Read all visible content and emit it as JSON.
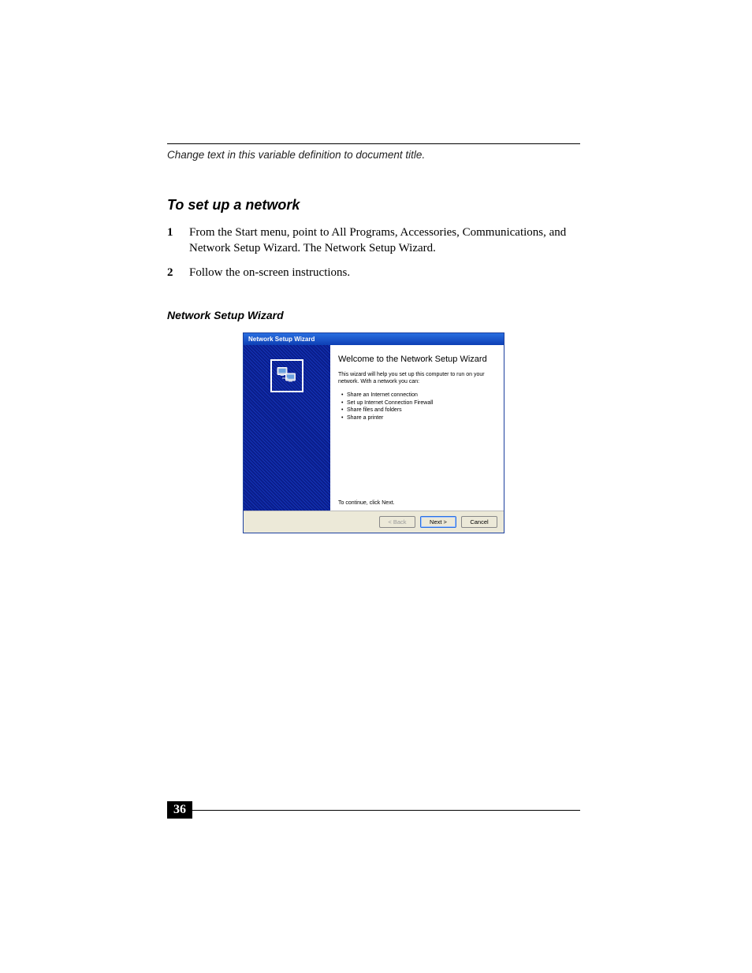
{
  "header": {
    "var_text": "Change text in this variable definition to document title."
  },
  "section": {
    "heading": "To set up a network",
    "steps": [
      {
        "n": "1",
        "text": "From the Start menu, point to All Programs, Accessories, Communications, and Network Setup Wizard. The Network Setup Wizard."
      },
      {
        "n": "2",
        "text": "Follow the on-screen instructions."
      }
    ],
    "sub_heading": "Network Setup Wizard"
  },
  "wizard": {
    "title": "Network Setup Wizard",
    "welcome": "Welcome to the Network Setup Wizard",
    "description": "This wizard will help you set up this computer to run on your network. With a network you can:",
    "bullets": [
      "Share an Internet connection",
      "Set up Internet Connection Firewall",
      "Share files and folders",
      "Share a printer"
    ],
    "continue_text": "To continue, click Next.",
    "buttons": {
      "back": "< Back",
      "next": "Next >",
      "cancel": "Cancel"
    }
  },
  "footer": {
    "page_number": "36"
  }
}
